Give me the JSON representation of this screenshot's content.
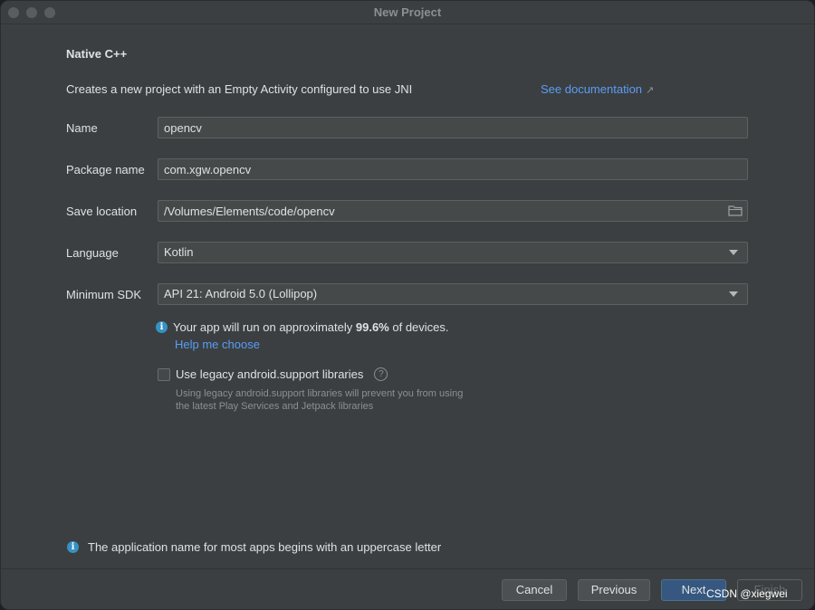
{
  "window": {
    "title": "New Project"
  },
  "header": {
    "section_title": "Native C++",
    "description": "Creates a new project with an Empty Activity configured to use JNI",
    "doc_link": "See documentation",
    "doc_link_arrow": "↗"
  },
  "form": {
    "name": {
      "label": "Name",
      "value": "opencv"
    },
    "package": {
      "label": "Package name",
      "value": "com.xgw.opencv"
    },
    "location": {
      "label": "Save location",
      "value": "/Volumes/Elements/code/opencv",
      "icon": "folder-icon"
    },
    "language": {
      "label": "Language",
      "value": "Kotlin"
    },
    "min_sdk": {
      "label": "Minimum SDK",
      "value": "API 21: Android 5.0 (Lollipop)"
    }
  },
  "sdk_info": {
    "prefix": "Your app will run on approximately",
    "percent": "99.6%",
    "suffix": "of devices.",
    "help_link": "Help me choose"
  },
  "legacy": {
    "label": "Use legacy android.support libraries",
    "checked": false,
    "help_icon": "?",
    "note_line1": "Using legacy android.support libraries will prevent you from using",
    "note_line2": "the latest Play Services and Jetpack libraries"
  },
  "bottom_info": {
    "text": "The application name for most apps begins with an uppercase letter"
  },
  "footer": {
    "cancel": "Cancel",
    "previous": "Previous",
    "next": "Next",
    "finish": "Finish"
  },
  "watermark": "CSDN @xiegwei",
  "colors": {
    "link": "#589df6",
    "primary_button": "#365880",
    "info": "#3592c4"
  }
}
